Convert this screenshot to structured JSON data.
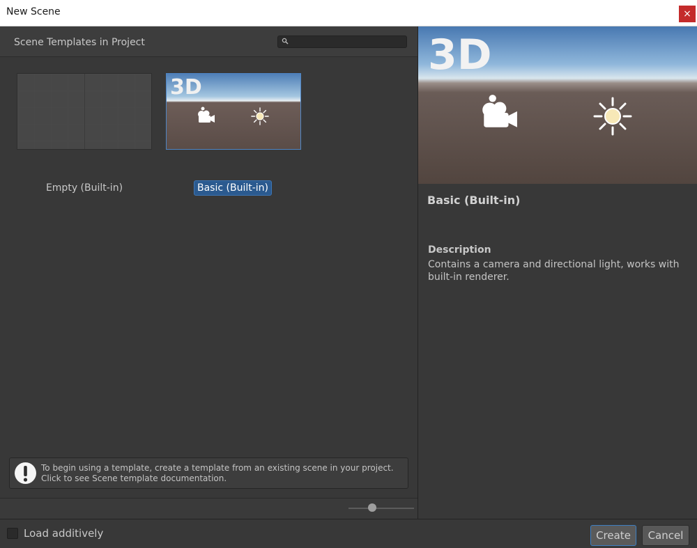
{
  "window": {
    "title": "New Scene",
    "close_label": "×"
  },
  "left": {
    "header": "Scene Templates in Project",
    "search_placeholder": "",
    "templates": [
      {
        "label": "Empty (Built-in)",
        "selected": false
      },
      {
        "label": "Basic (Built-in)",
        "selected": true,
        "thumb_text": "3D"
      }
    ],
    "info": "To begin using a template, create a template from an existing scene in your project. Click to see Scene template documentation."
  },
  "right": {
    "preview_text": "3D",
    "name": "Basic (Built-in)",
    "description_heading": "Description",
    "description": "Contains a camera and directional light, works with built-in renderer."
  },
  "footer": {
    "load_additively": "Load additively",
    "load_additively_checked": false,
    "create": "Create",
    "cancel": "Cancel"
  },
  "icons": [
    "search-icon",
    "camera-icon",
    "sun-icon",
    "warning-icon",
    "close-icon"
  ],
  "colors": {
    "selection": "#2b5a8f",
    "close": "#c42b2b",
    "accent": "#3d7fc2"
  }
}
